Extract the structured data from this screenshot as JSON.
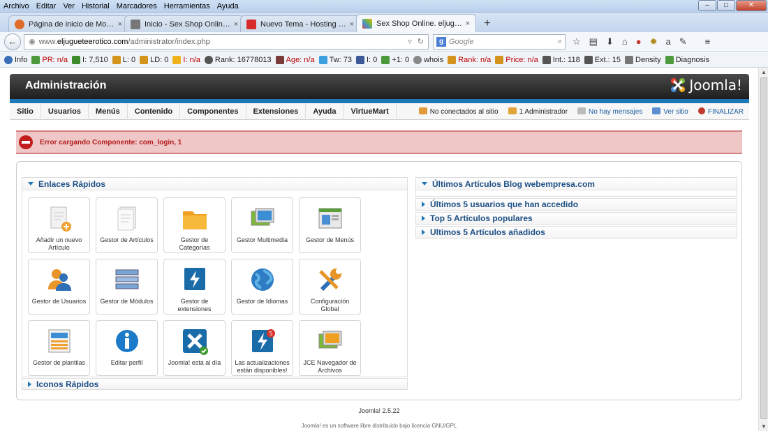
{
  "browser": {
    "menu": [
      "Archivo",
      "Editar",
      "Ver",
      "Historial",
      "Marcadores",
      "Herramientas",
      "Ayuda"
    ],
    "tabs": [
      {
        "title": "Página de inicio de Mozilla...",
        "color": "#e06b2a"
      },
      {
        "title": "Inicio - Sex Shop Online. elj...",
        "color": "#666"
      },
      {
        "title": "Nuevo Tema - Hosting Wo...",
        "color": "#d62b2b"
      },
      {
        "title": "Sex Shop Online. eljuguete...",
        "color": "#4a8ed4"
      }
    ],
    "url_prefix": "www.",
    "url_domain": "eljugueteerotico.com",
    "url_path": "/administrator/index.php",
    "search_placeholder": "Google"
  },
  "seo": [
    "Info",
    "PR: n/a",
    "I: 7,510",
    "L: 0",
    "LD: 0",
    "I: n/a",
    "Rank: 16778013",
    "Age: n/a",
    "Tw: 73",
    "I: 0",
    "+1: 0",
    "whois",
    "Rank: n/a",
    "Price: n/a",
    "Int.: 118",
    "Ext.: 15",
    "Density",
    "Diagnosis"
  ],
  "header": {
    "title": "Administración",
    "logo": "Joomla!"
  },
  "menu": {
    "items": [
      "Sitio",
      "Usuarios",
      "Menús",
      "Contenido",
      "Componentes",
      "Extensiones",
      "Ayuda",
      "VirtueMart"
    ],
    "not_connected": "No conectados al sitio",
    "admin": "1 Administrador",
    "messages": "No hay mensajes",
    "view_site": "Ver sitio",
    "logout": "FINALIZAR"
  },
  "error": "Error cargando Componente: com_login, 1",
  "quicklinks": {
    "title": "Enlaces Rápidos",
    "icons": [
      {
        "label": "Añadir un nuevo Artículo",
        "icon": "add-article-icon"
      },
      {
        "label": "Gestor de Artículos",
        "icon": "article-manager-icon"
      },
      {
        "label": "Gestor de Categorías",
        "icon": "folder-icon"
      },
      {
        "label": "Gestor Multimedia",
        "icon": "media-icon"
      },
      {
        "label": "Gestor de Menús",
        "icon": "menu-manager-icon"
      },
      {
        "label": "Gestor de Usuarios",
        "icon": "users-icon"
      },
      {
        "label": "Gestor de Módulos",
        "icon": "modules-icon"
      },
      {
        "label": "Gestor de extensiones",
        "icon": "extensions-icon"
      },
      {
        "label": "Gestor de Idiomas",
        "icon": "globe-icon"
      },
      {
        "label": "Configuración Global",
        "icon": "tools-icon"
      },
      {
        "label": "Gestor de plantilas",
        "icon": "templates-icon"
      },
      {
        "label": "Editar perfil",
        "icon": "info-icon"
      },
      {
        "label": "Joomla! esta al día",
        "icon": "joomla-check-icon"
      },
      {
        "label": "Las actualizaciones están disponibles!",
        "icon": "updates-icon"
      },
      {
        "label": "JCE Navegador de Archivos",
        "icon": "file-browser-icon"
      }
    ],
    "quickicons_title": "Iconos Rápidos"
  },
  "right_panels": [
    {
      "title": "Últimos Artículos Blog webempresa.com",
      "open": true
    },
    {
      "title": "Últimos 5 usuarios que han accedido",
      "open": false
    },
    {
      "title": "Top 5 Artículos populares",
      "open": false
    },
    {
      "title": "Ultimos 5 Artículos añadidos",
      "open": false
    }
  ],
  "footer": {
    "version": "Joomla! 2.5.22",
    "license": "Joomla! es un software libre distribuido bajo licencia GNU/GPL"
  }
}
